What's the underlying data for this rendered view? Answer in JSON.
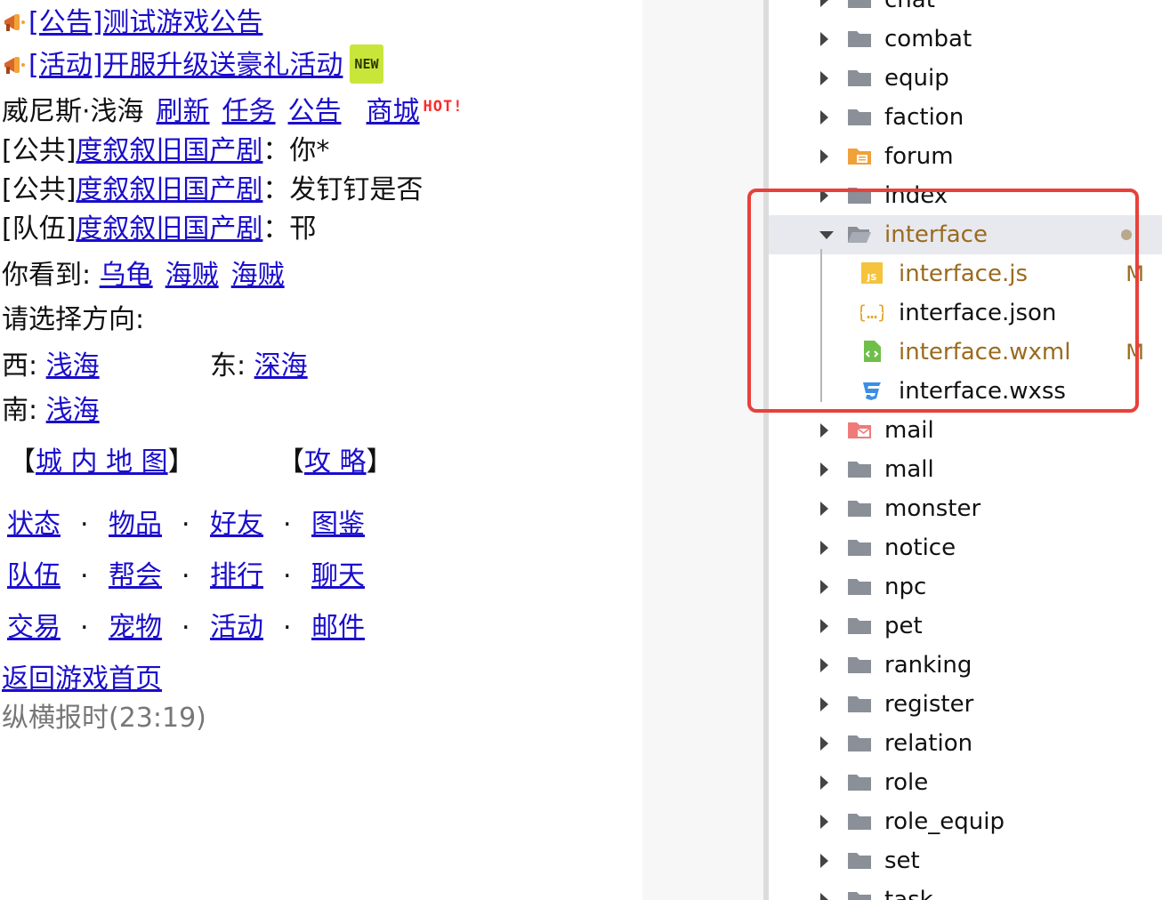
{
  "game": {
    "notices": [
      {
        "text": "[公告]测试游戏公告",
        "badge": ""
      },
      {
        "text": "[活动]开服升级送豪礼活动",
        "badge": "NEW"
      }
    ],
    "location": {
      "name": "威尼斯·浅海",
      "links": [
        "刷新",
        "任务",
        "公告"
      ],
      "mall": "商城",
      "hot": "HOT!"
    },
    "chat": [
      {
        "channel": "[公共]",
        "user": "度叙叙旧国产剧",
        "sep": "：",
        "msg": "你*"
      },
      {
        "channel": "[公共]",
        "user": "度叙叙旧国产剧",
        "sep": "：",
        "msg": "发钉钉是否"
      },
      {
        "channel": "[队伍]",
        "user": "度叙叙旧国产剧",
        "sep": "：",
        "msg": "邗"
      }
    ],
    "see": {
      "label": "你看到: ",
      "items": [
        "乌龟",
        "海贼",
        "海贼"
      ]
    },
    "choose_dir": "请选择方向:",
    "dirs": {
      "west_label": "西: ",
      "west": "浅海",
      "east_label": "东: ",
      "east": "深海",
      "south_label": "南: ",
      "south": "浅海"
    },
    "map": {
      "open": "【",
      "close": "】",
      "city_map": "城 内 地 图",
      "guide": "攻 略"
    },
    "nav": [
      [
        "状态",
        "物品",
        "好友",
        "图鉴"
      ],
      [
        "队伍",
        "帮会",
        "排行",
        "聊天"
      ],
      [
        "交易",
        "宠物",
        "活动",
        "邮件"
      ]
    ],
    "nav_sep": ".",
    "back": "返回游戏首页",
    "time": "纵横报时(23:19)"
  },
  "tree": {
    "items": [
      {
        "label": "chat",
        "type": "folder",
        "icon": "folder-icon"
      },
      {
        "label": "combat",
        "type": "folder",
        "icon": "folder-icon"
      },
      {
        "label": "equip",
        "type": "folder",
        "icon": "folder-icon"
      },
      {
        "label": "faction",
        "type": "folder",
        "icon": "folder-icon"
      },
      {
        "label": "forum",
        "type": "folder",
        "icon": "forum-folder-icon"
      },
      {
        "label": "index",
        "type": "folder",
        "icon": "folder-icon"
      },
      {
        "label": "interface",
        "type": "folder-open",
        "icon": "folder-open-icon",
        "status": "●"
      },
      {
        "label": "interface.js",
        "type": "file",
        "icon": "js-file-icon",
        "status": "M"
      },
      {
        "label": "interface.json",
        "type": "file",
        "icon": "json-file-icon",
        "status": ""
      },
      {
        "label": "interface.wxml",
        "type": "file",
        "icon": "wxml-file-icon",
        "status": "M"
      },
      {
        "label": "interface.wxss",
        "type": "file",
        "icon": "wxss-file-icon",
        "status": ""
      },
      {
        "label": "mail",
        "type": "folder",
        "icon": "mail-folder-icon"
      },
      {
        "label": "mall",
        "type": "folder",
        "icon": "folder-icon"
      },
      {
        "label": "monster",
        "type": "folder",
        "icon": "folder-icon"
      },
      {
        "label": "notice",
        "type": "folder",
        "icon": "folder-icon"
      },
      {
        "label": "npc",
        "type": "folder",
        "icon": "folder-icon"
      },
      {
        "label": "pet",
        "type": "folder",
        "icon": "folder-icon"
      },
      {
        "label": "ranking",
        "type": "folder",
        "icon": "folder-icon"
      },
      {
        "label": "register",
        "type": "folder",
        "icon": "folder-icon"
      },
      {
        "label": "relation",
        "type": "folder",
        "icon": "folder-icon"
      },
      {
        "label": "role",
        "type": "folder",
        "icon": "folder-icon"
      },
      {
        "label": "role_equip",
        "type": "folder",
        "icon": "folder-icon"
      },
      {
        "label": "set",
        "type": "folder",
        "icon": "folder-icon"
      },
      {
        "label": "task",
        "type": "folder",
        "icon": "folder-icon"
      }
    ],
    "colors": {
      "modified": "#9a6b1f",
      "highlight_box": "#e8413a",
      "folder": "#8a8f98",
      "selected_bg": "#e8e9ef"
    }
  }
}
